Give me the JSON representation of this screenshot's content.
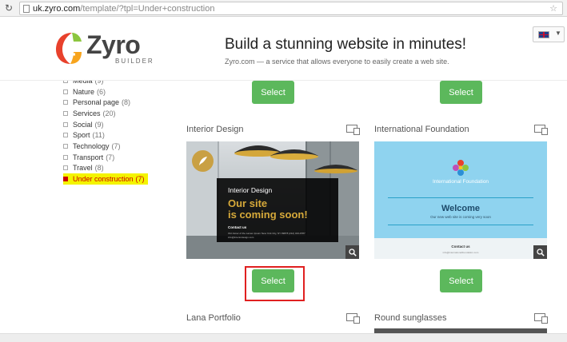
{
  "browser": {
    "url_host": "uk.zyro.com",
    "url_path": "/template/?tpl=Under+construction"
  },
  "header": {
    "logo_text": "Zyro",
    "logo_sub": "BUILDER",
    "headline": "Build a stunning website in minutes!",
    "subline": "Zyro.com — a service that allows everyone to easily create a web site."
  },
  "sidebar": {
    "categories": [
      {
        "label": "Media",
        "count": "(9)"
      },
      {
        "label": "Nature",
        "count": "(6)"
      },
      {
        "label": "Personal page",
        "count": "(8)"
      },
      {
        "label": "Services",
        "count": "(20)"
      },
      {
        "label": "Social",
        "count": "(9)"
      },
      {
        "label": "Sport",
        "count": "(11)"
      },
      {
        "label": "Technology",
        "count": "(7)"
      },
      {
        "label": "Transport",
        "count": "(7)"
      },
      {
        "label": "Travel",
        "count": "(8)"
      },
      {
        "label": "Under construction",
        "count": "(7)"
      }
    ]
  },
  "cards": {
    "select_label": "Select",
    "interior": {
      "title": "Interior Design",
      "thumb_name": "Interior Design",
      "thumb_headline_1": "Our site",
      "thumb_headline_2": "is coming soon!",
      "thumb_contact": "Contact us",
      "thumb_address": "Old Joiner of the Lamen Ipsum New York City, NY 99878 (212) 323-9787",
      "thumb_email": "info@interiordesign.com"
    },
    "foundation": {
      "title": "International Foundation",
      "thumb_name": "International Foundation",
      "thumb_welcome": "Welcome",
      "thumb_sub": "Our new web site is coming very soon",
      "thumb_contact": "Contact us",
      "thumb_small": "info@internationalfoundation.com"
    },
    "lana": {
      "title": "Lana Portfolio"
    },
    "sunglasses": {
      "title": "Round sunglasses"
    }
  }
}
